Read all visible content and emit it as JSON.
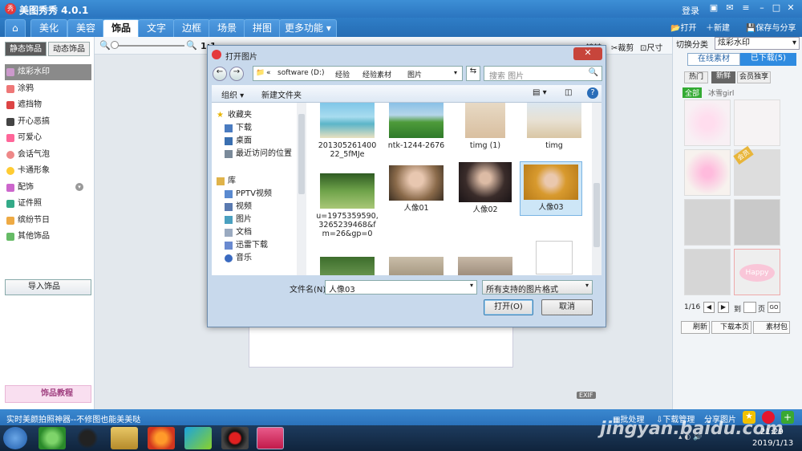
{
  "app": {
    "title": "美图秀秀 4.0.1",
    "logo_text": "秀",
    "login": "登录"
  },
  "nav": {
    "tabs": [
      "美化",
      "美容",
      "饰品",
      "文字",
      "边框",
      "场景",
      "拼图",
      "更多功能"
    ],
    "open": "打开",
    "new": "新建",
    "save": "保存与分享"
  },
  "toolbar": {
    "zoom": "1:1",
    "exif": "EXIF",
    "flip_label": "镜转",
    "crop": "裁剪",
    "size": "尺寸"
  },
  "left": {
    "tabs": [
      "静态饰品",
      "动态饰品"
    ],
    "items": [
      "炫彩水印",
      "涂鸦",
      "遮挡物",
      "开心恶搞",
      "可爱心",
      "会话气泡",
      "卡通形象",
      "配饰",
      "证件照",
      "缤纷节日",
      "其他饰品"
    ],
    "import": "导入饰品",
    "tutorial": "饰品教程"
  },
  "right": {
    "switch_label": "切换分类",
    "category": "炫彩水印",
    "tabs": [
      "在线素材",
      "已下载(5)"
    ],
    "filters": [
      "热门",
      "新鲜",
      "会员独享"
    ],
    "all": "全部",
    "tag": "冰雪girl",
    "page": "1/16",
    "goto": "到",
    "page_unit": "页",
    "go": "GO",
    "refresh": "刷新",
    "download": "下载本页",
    "pack": "素材包",
    "badge": "会员"
  },
  "dialog": {
    "title": "打开图片",
    "path": [
      "«",
      "software (D:)",
      "经验",
      "经验素材",
      "图片"
    ],
    "search": "搜索 图片",
    "organize": "组织 ▾",
    "new_folder": "新建文件夹",
    "nav": [
      "收藏夹",
      "下载",
      "桌面",
      "最近访问的位置",
      "库",
      "PPTV视频",
      "视频",
      "图片",
      "文档",
      "迅雷下载",
      "音乐"
    ],
    "files": [
      "201305261400 22_5fMJe",
      "ntk-1244-2676",
      "timg (1)",
      "timg",
      "u=1975359590, 3265239468&f m=26&gp=0",
      "人像01",
      "人像02",
      "人像03"
    ],
    "filename_label": "文件名(N):",
    "filename": "人像03",
    "filetype": "所有支持的图片格式",
    "open": "打开(O)",
    "cancel": "取消"
  },
  "status": {
    "text": "实时美颜拍照神器--不修图也能美美哒",
    "batch": "批处理",
    "download_mgr": "下载管理",
    "share": "分享图片"
  },
  "taskbar": {
    "time": "21:29",
    "date": "2019/1/13"
  },
  "watermark": "jingyan.baidu.com"
}
